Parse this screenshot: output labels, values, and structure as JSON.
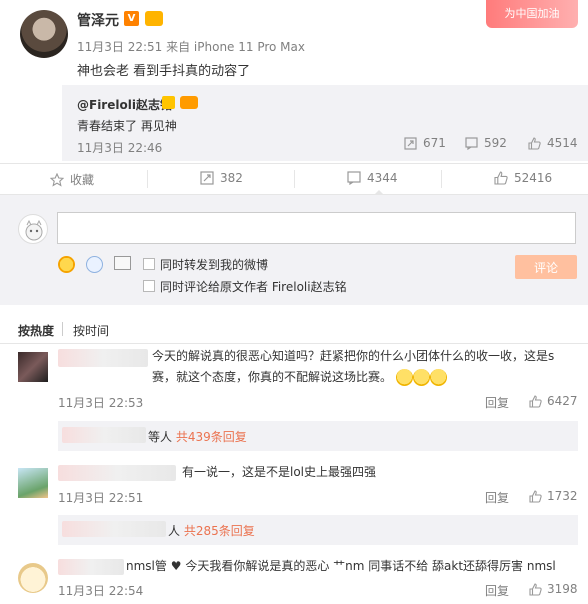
{
  "post": {
    "username": "管泽元",
    "meta": "11月3日 22:51 来自 iPhone 11 Pro Max",
    "text": "神也会老 看到手抖真的动容了",
    "corner_ad": "为中国加油"
  },
  "repost": {
    "user": "@Fireloli赵志铭",
    "text": "青春结束了 再见神",
    "time": "11月3日 22:46",
    "reposts": "671",
    "comments": "592",
    "likes": "4514"
  },
  "actions": {
    "favorite": "收藏",
    "repost": "382",
    "comment": "4344",
    "like": "52416"
  },
  "composer": {
    "placeholder": "",
    "forward_label": "同时转发到我的微博",
    "comment_original_label": "同时评论给原文作者 Fireloli赵志铭",
    "submit": "评论"
  },
  "sort": {
    "hot": "按热度",
    "time": "按时间"
  },
  "comments": [
    {
      "text": "今天的解说真的很恶心知道吗？赶紧把你的什么小团体什么的收一收，这是s赛，就这个态度，你真的不配解说这场比赛。",
      "time": "11月3日 22:53",
      "reply": "回复",
      "likes": "6427",
      "subreply_prefix": "等人",
      "subreply_count": "共439条回复"
    },
    {
      "text": "有一说一，这是不是lol史上最强四强",
      "time": "11月3日 22:51",
      "reply": "回复",
      "likes": "1732",
      "subreply_prefix": "人",
      "subreply_count": "共285条回复"
    },
    {
      "text_prefix": "nmsl管",
      "text": "今天我看你解说是真的恶心 艹nm 同事话不给 舔akt还舔得厉害 nmsl",
      "time": "11月3日 22:54",
      "reply": "回复",
      "likes": "3198"
    }
  ],
  "colors": {
    "accent": "#ff8200",
    "link": "#eb7350",
    "muted": "#808080",
    "panel": "#f2f2f5"
  }
}
